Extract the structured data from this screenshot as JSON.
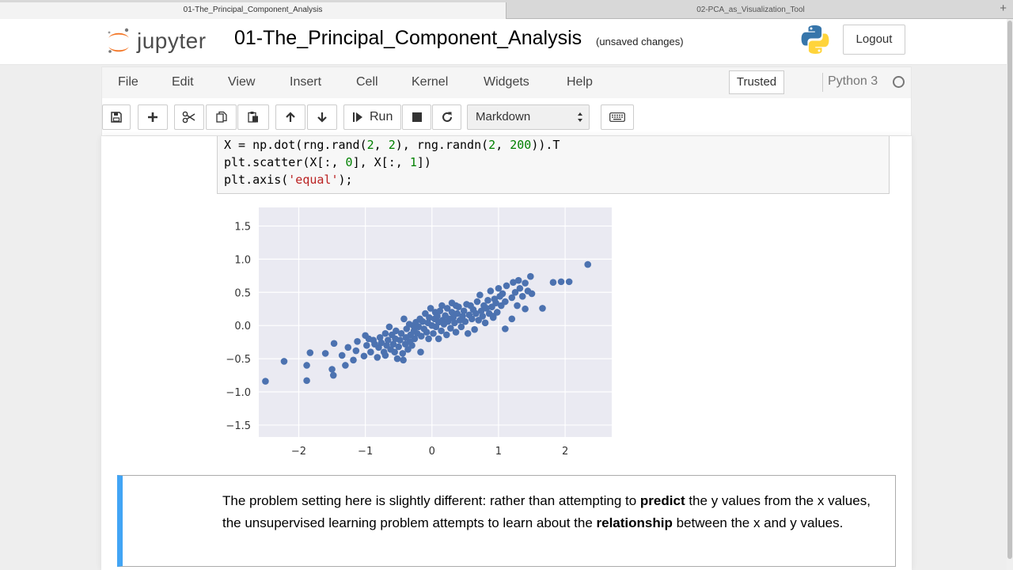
{
  "browser": {
    "tabs": [
      {
        "label": "01-The_Principal_Component_Analysis"
      },
      {
        "label": "02-PCA_as_Visualization_Tool"
      }
    ],
    "new_tab": "+"
  },
  "header": {
    "logo_text": "jupyter",
    "notebook_title": "01-The_Principal_Component_Analysis",
    "save_status": "(unsaved changes)",
    "logout_label": "Logout"
  },
  "menubar": {
    "items": [
      "File",
      "Edit",
      "View",
      "Insert",
      "Cell",
      "Kernel",
      "Widgets",
      "Help"
    ],
    "trusted_label": "Trusted",
    "kernel_name": "Python 3"
  },
  "toolbar": {
    "run_label": "Run",
    "cell_type": "Markdown",
    "icons": [
      "save-icon",
      "plus-icon",
      "cut-icon",
      "copy-icon",
      "paste-icon",
      "arrow-up-icon",
      "arrow-down-icon",
      "run-icon",
      "stop-icon",
      "restart-icon",
      "keyboard-icon"
    ]
  },
  "code_cell": {
    "lines": [
      {
        "p1": "X = np.dot(rng.rand(",
        "n1": "2",
        "p2": ", ",
        "n2": "2",
        "p3": "), rng.randn(",
        "n3": "2",
        "p4": ", ",
        "n4": "200",
        "p5": ")).T"
      },
      {
        "p1": "plt.scatter(X[:, ",
        "n1": "0",
        "p2": "], X[:, ",
        "n2": "1",
        "p3": "])"
      },
      {
        "p1": "plt.axis(",
        "s1": "'equal'",
        "p2": ");"
      }
    ]
  },
  "chart_data": {
    "type": "scatter",
    "title": "",
    "xlabel": "",
    "ylabel": "",
    "xlim": [
      -2.6,
      2.7
    ],
    "ylim": [
      -1.68,
      1.78
    ],
    "x_ticks": [
      "−2",
      "−1",
      "0",
      "1",
      "2"
    ],
    "x_tick_values": [
      -2,
      -1,
      0,
      1,
      2
    ],
    "y_ticks": [
      "1.5",
      "1.0",
      "0.5",
      "0.0",
      "−0.5",
      "−1.0",
      "−1.5"
    ],
    "y_tick_values": [
      1.5,
      1.0,
      0.5,
      0.0,
      -0.5,
      -1.0,
      -1.5
    ],
    "grid": true,
    "background": "#eaeaf2",
    "point_color": "#4c72b0",
    "points": [
      [
        -2.5,
        -0.84
      ],
      [
        -2.22,
        -0.54
      ],
      [
        -1.88,
        -0.83
      ],
      [
        -1.88,
        -0.6
      ],
      [
        -1.83,
        -0.41
      ],
      [
        -1.5,
        -0.66
      ],
      [
        -1.48,
        -0.75
      ],
      [
        -1.47,
        -0.27
      ],
      [
        -1.35,
        -0.45
      ],
      [
        -1.3,
        -0.6
      ],
      [
        -1.26,
        -0.33
      ],
      [
        -1.18,
        -0.52
      ],
      [
        -1.14,
        -0.38
      ],
      [
        -1.12,
        -0.24
      ],
      [
        -1.02,
        -0.46
      ],
      [
        -0.98,
        -0.3
      ],
      [
        -0.95,
        -0.2
      ],
      [
        -0.92,
        -0.4
      ],
      [
        -0.88,
        -0.22
      ],
      [
        -0.86,
        -0.28
      ],
      [
        -0.82,
        -0.48
      ],
      [
        -0.8,
        -0.33
      ],
      [
        -0.78,
        -0.18
      ],
      [
        -0.76,
        -0.26
      ],
      [
        -0.72,
        -0.4
      ],
      [
        -0.7,
        -0.12
      ],
      [
        -0.68,
        -0.3
      ],
      [
        -0.66,
        -0.22
      ],
      [
        -0.64,
        -0.02
      ],
      [
        -0.62,
        -0.36
      ],
      [
        -0.6,
        -0.14
      ],
      [
        -0.58,
        -0.28
      ],
      [
        -0.56,
        -0.4
      ],
      [
        -0.55,
        -0.2
      ],
      [
        -0.54,
        -0.08
      ],
      [
        -0.52,
        -0.5
      ],
      [
        -0.5,
        -0.32
      ],
      [
        -0.48,
        -0.22
      ],
      [
        -0.46,
        -0.12
      ],
      [
        -0.44,
        -0.42
      ],
      [
        -0.43,
        -0.52
      ],
      [
        -0.42,
        0.1
      ],
      [
        -0.4,
        -0.28
      ],
      [
        -0.39,
        -0.18
      ],
      [
        -0.38,
        -0.05
      ],
      [
        -0.36,
        -0.36
      ],
      [
        -0.34,
        0.02
      ],
      [
        -0.33,
        -0.24
      ],
      [
        -0.32,
        -0.14
      ],
      [
        -0.3,
        -0.3
      ],
      [
        -0.28,
        0.0
      ],
      [
        -0.27,
        -0.08
      ],
      [
        -0.26,
        -0.2
      ],
      [
        -0.24,
        0.05
      ],
      [
        -0.22,
        -0.12
      ],
      [
        -0.2,
        -0.02
      ],
      [
        -0.18,
        0.1
      ],
      [
        -0.17,
        -0.4
      ],
      [
        -0.16,
        -0.16
      ],
      [
        -0.14,
        0.06
      ],
      [
        -0.12,
        -0.05
      ],
      [
        -0.1,
        0.18
      ],
      [
        -0.08,
        -0.1
      ],
      [
        -0.06,
        0.04
      ],
      [
        -0.05,
        -0.2
      ],
      [
        -0.04,
        0.12
      ],
      [
        -0.02,
        0.26
      ],
      [
        0.0,
        0.0
      ],
      [
        0.02,
        -0.12
      ],
      [
        0.04,
        0.1
      ],
      [
        0.05,
        0.2
      ],
      [
        0.06,
        -0.02
      ],
      [
        0.08,
        0.14
      ],
      [
        0.1,
        -0.2
      ],
      [
        0.1,
        0.05
      ],
      [
        0.12,
        0.22
      ],
      [
        0.14,
        -0.08
      ],
      [
        0.15,
        0.3
      ],
      [
        0.16,
        0.08
      ],
      [
        0.18,
        0.02
      ],
      [
        0.2,
        0.15
      ],
      [
        0.22,
        -0.14
      ],
      [
        0.23,
        0.26
      ],
      [
        0.24,
        0.06
      ],
      [
        0.26,
        0.1
      ],
      [
        0.28,
        -0.04
      ],
      [
        0.3,
        0.2
      ],
      [
        0.3,
        0.34
      ],
      [
        0.32,
        0.12
      ],
      [
        0.34,
        0.04
      ],
      [
        0.36,
        -0.1
      ],
      [
        0.38,
        0.18
      ],
      [
        0.4,
        0.28
      ],
      [
        0.42,
        0.08
      ],
      [
        0.44,
        -0.02
      ],
      [
        0.46,
        0.14
      ],
      [
        0.48,
        0.22
      ],
      [
        0.5,
        0.06
      ],
      [
        0.52,
        0.32
      ],
      [
        0.54,
        -0.12
      ],
      [
        0.56,
        0.16
      ],
      [
        0.58,
        0.3
      ],
      [
        0.6,
        0.1
      ],
      [
        0.62,
        0.24
      ],
      [
        0.64,
        -0.06
      ],
      [
        0.66,
        0.18
      ],
      [
        0.68,
        0.36
      ],
      [
        0.7,
        0.08
      ],
      [
        0.72,
        0.46
      ],
      [
        0.74,
        0.22
      ],
      [
        0.76,
        0.14
      ],
      [
        0.78,
        0.3
      ],
      [
        0.8,
        0.04
      ],
      [
        0.82,
        0.26
      ],
      [
        0.84,
        0.38
      ],
      [
        0.86,
        0.18
      ],
      [
        0.88,
        0.52
      ],
      [
        0.9,
        0.28
      ],
      [
        0.92,
        0.12
      ],
      [
        0.94,
        0.4
      ],
      [
        0.96,
        0.34
      ],
      [
        0.98,
        0.2
      ],
      [
        1.0,
        0.56
      ],
      [
        1.02,
        0.44
      ],
      [
        1.04,
        0.3
      ],
      [
        1.06,
        0.48
      ],
      [
        1.1,
        0.36
      ],
      [
        1.12,
        0.6
      ],
      [
        1.1,
        -0.05
      ],
      [
        1.2,
        0.42
      ],
      [
        1.22,
        0.65
      ],
      [
        1.25,
        0.5
      ],
      [
        1.28,
        0.3
      ],
      [
        1.3,
        0.68
      ],
      [
        1.32,
        0.56
      ],
      [
        1.36,
        0.44
      ],
      [
        1.4,
        0.64
      ],
      [
        1.44,
        0.52
      ],
      [
        1.48,
        0.74
      ],
      [
        1.5,
        0.48
      ],
      [
        1.66,
        0.26
      ],
      [
        1.82,
        0.65
      ],
      [
        1.94,
        0.66
      ],
      [
        2.06,
        0.66
      ],
      [
        2.34,
        0.92
      ],
      [
        -1.0,
        -0.15
      ],
      [
        -0.7,
        -0.45
      ],
      [
        0.36,
        0.3
      ],
      [
        0.92,
        0.14
      ],
      [
        1.2,
        0.1
      ],
      [
        1.4,
        0.25
      ],
      [
        -1.6,
        -0.42
      ]
    ]
  },
  "markdown_cell": {
    "t1": "The problem setting here is slightly different: rather than attempting to ",
    "b1": "predict",
    "t2": " the y values from the x values, the unsupervised learning problem attempts to learn about the ",
    "b2": "relationship",
    "t3": " between the x and y values."
  }
}
